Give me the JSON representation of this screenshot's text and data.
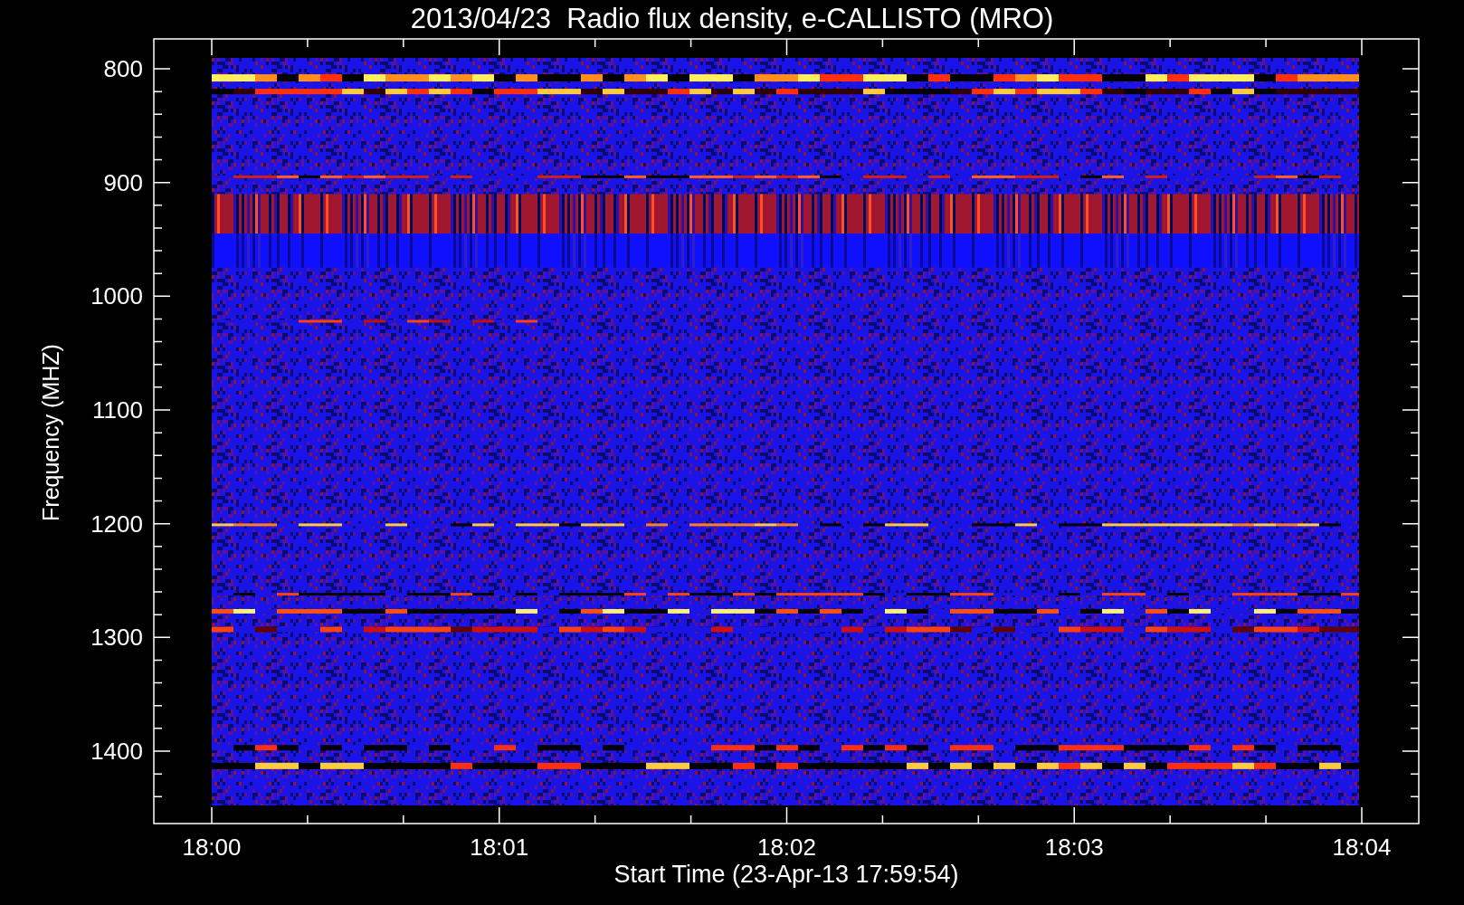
{
  "title": "2013/04/23  Radio flux density, e-CALLISTO (MRO)",
  "ylabel": "Frequency (MHZ)",
  "xlabel": "Start Time (23-Apr-13 17:59:54)",
  "yticks": [
    "800",
    "900",
    "1000",
    "1100",
    "1200",
    "1300",
    "1400"
  ],
  "xticks": [
    "18:00",
    "18:01",
    "18:02",
    "18:03",
    "18:04"
  ]
}
